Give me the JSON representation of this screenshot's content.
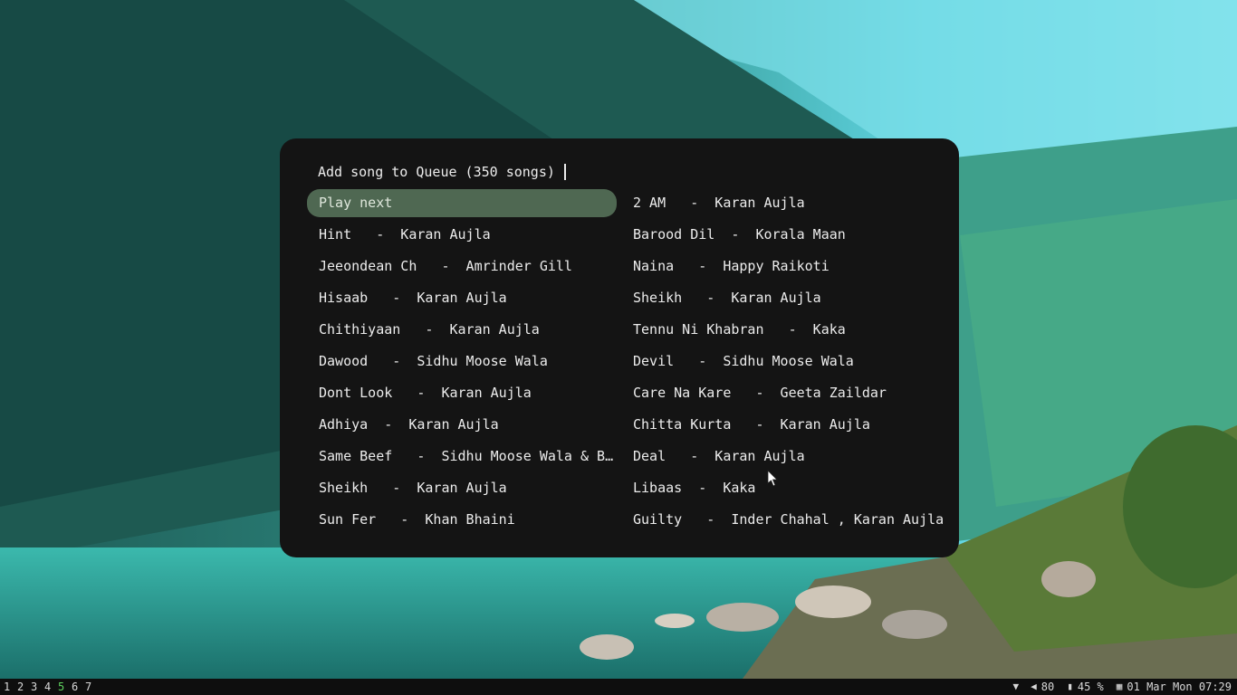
{
  "launcher": {
    "prompt": "Add song to Queue (350 songs)",
    "left_column": [
      "Play next",
      "Hint   -  Karan Aujla",
      "Jeeondean Ch   -  Amrinder Gill",
      "Hisaab   -  Karan Aujla",
      "Chithiyaan   -  Karan Aujla",
      "Dawood   -  Sidhu Moose Wala",
      "Dont Look   -  Karan Aujla",
      "Adhiya  -  Karan Aujla",
      "Same Beef   -  Sidhu Moose Wala & Bohem…",
      "Sheikh   -  Karan Aujla",
      "Sun Fer   -  Khan Bhaini"
    ],
    "right_column": [
      "2 AM   -  Karan Aujla",
      "Barood Dil  -  Korala Maan",
      "Naina   -  Happy Raikoti",
      "Sheikh   -  Karan Aujla",
      "Tennu Ni Khabran   -  Kaka",
      "Devil   -  Sidhu Moose Wala",
      "Care Na Kare   -  Geeta Zaildar",
      "Chitta Kurta   -  Karan Aujla",
      "Deal   -  Karan Aujla",
      "Libaas  -  Kaka",
      "Guilty   -  Inder Chahal , Karan Aujla"
    ],
    "selected_color": "#4f6852"
  },
  "bar": {
    "workspaces": [
      "1",
      "2",
      "3",
      "4",
      "5",
      "6",
      "7"
    ],
    "active_workspace": "5",
    "volume": "80",
    "battery": "45 %",
    "datetime": "01 Mar Mon 07:29",
    "icons": {
      "wifi": "wifi-icon",
      "volume": "speaker-icon",
      "battery": "battery-icon",
      "calendar": "calendar-icon"
    }
  }
}
